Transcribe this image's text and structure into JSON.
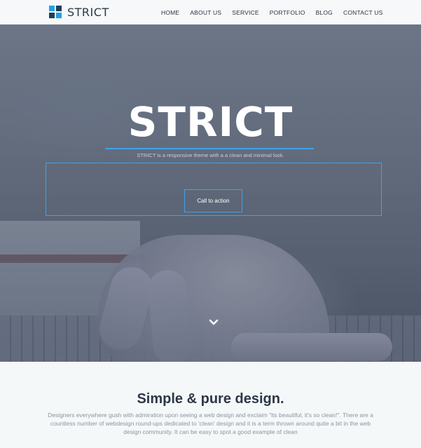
{
  "brand": {
    "name": "STRICT"
  },
  "nav": {
    "items": [
      "HOME",
      "ABOUT US",
      "SERVICE",
      "PORTFOLIO",
      "BLOG",
      "CONTACT US"
    ]
  },
  "hero": {
    "title": "STRICT",
    "subtitle": "STRICT is a responsive theme with a a clean and minimal look.",
    "cta_label": "Call to action"
  },
  "section": {
    "heading": "Simple & pure design.",
    "body": "Designers everywhere gush with admiration upon seeing a web design and exclaim \"its beautiful, it's so clean!\". There are a countless number of webdesign round-ups dedicated to 'clean' design and it is a term thrown around quite a bit in the web design community. It can be easy to spot a good example of clean"
  },
  "colors": {
    "accent": "#3ea3e8",
    "dark": "#1f3e5a",
    "text": "#2d3846"
  }
}
